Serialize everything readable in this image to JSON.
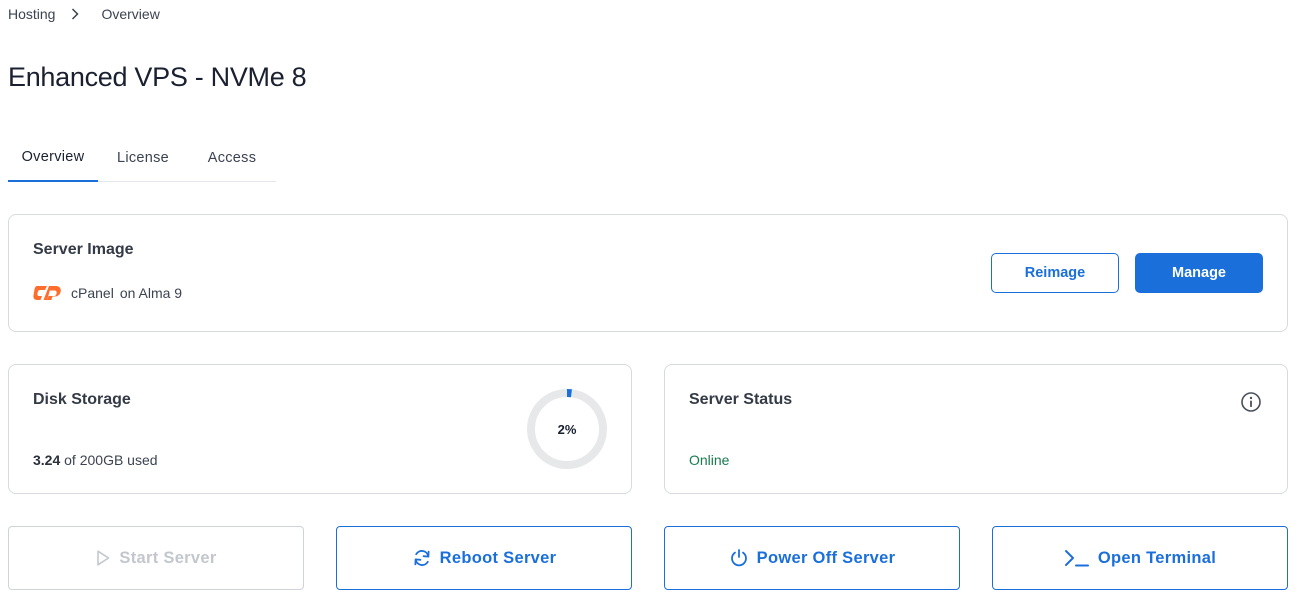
{
  "breadcrumb": {
    "root": "Hosting",
    "current": "Overview"
  },
  "page": {
    "title": "Enhanced VPS - NVMe 8"
  },
  "tabs": [
    {
      "label": "Overview",
      "active": true
    },
    {
      "label": "License",
      "active": false
    },
    {
      "label": "Access",
      "active": false
    }
  ],
  "server_image": {
    "title": "Server Image",
    "product": "cPanel",
    "os": "on Alma 9",
    "logo_icon": "cpanel-logo",
    "reimage_label": "Reimage",
    "manage_label": "Manage"
  },
  "disk": {
    "title": "Disk Storage",
    "used": "3.24",
    "total_text": "of 200GB used",
    "percent_label": "2%",
    "percent": 2
  },
  "status": {
    "title": "Server Status",
    "value": "Online",
    "info_icon": "info-icon"
  },
  "actions": {
    "start": "Start Server",
    "reboot": "Reboot Server",
    "power_off": "Power Off Server",
    "terminal": "Open Terminal"
  },
  "colors": {
    "accent": "#1b6fdb",
    "online": "#1b7a4e",
    "cpanel": "#ff6c2c",
    "disabled": "#c3c7cd"
  }
}
